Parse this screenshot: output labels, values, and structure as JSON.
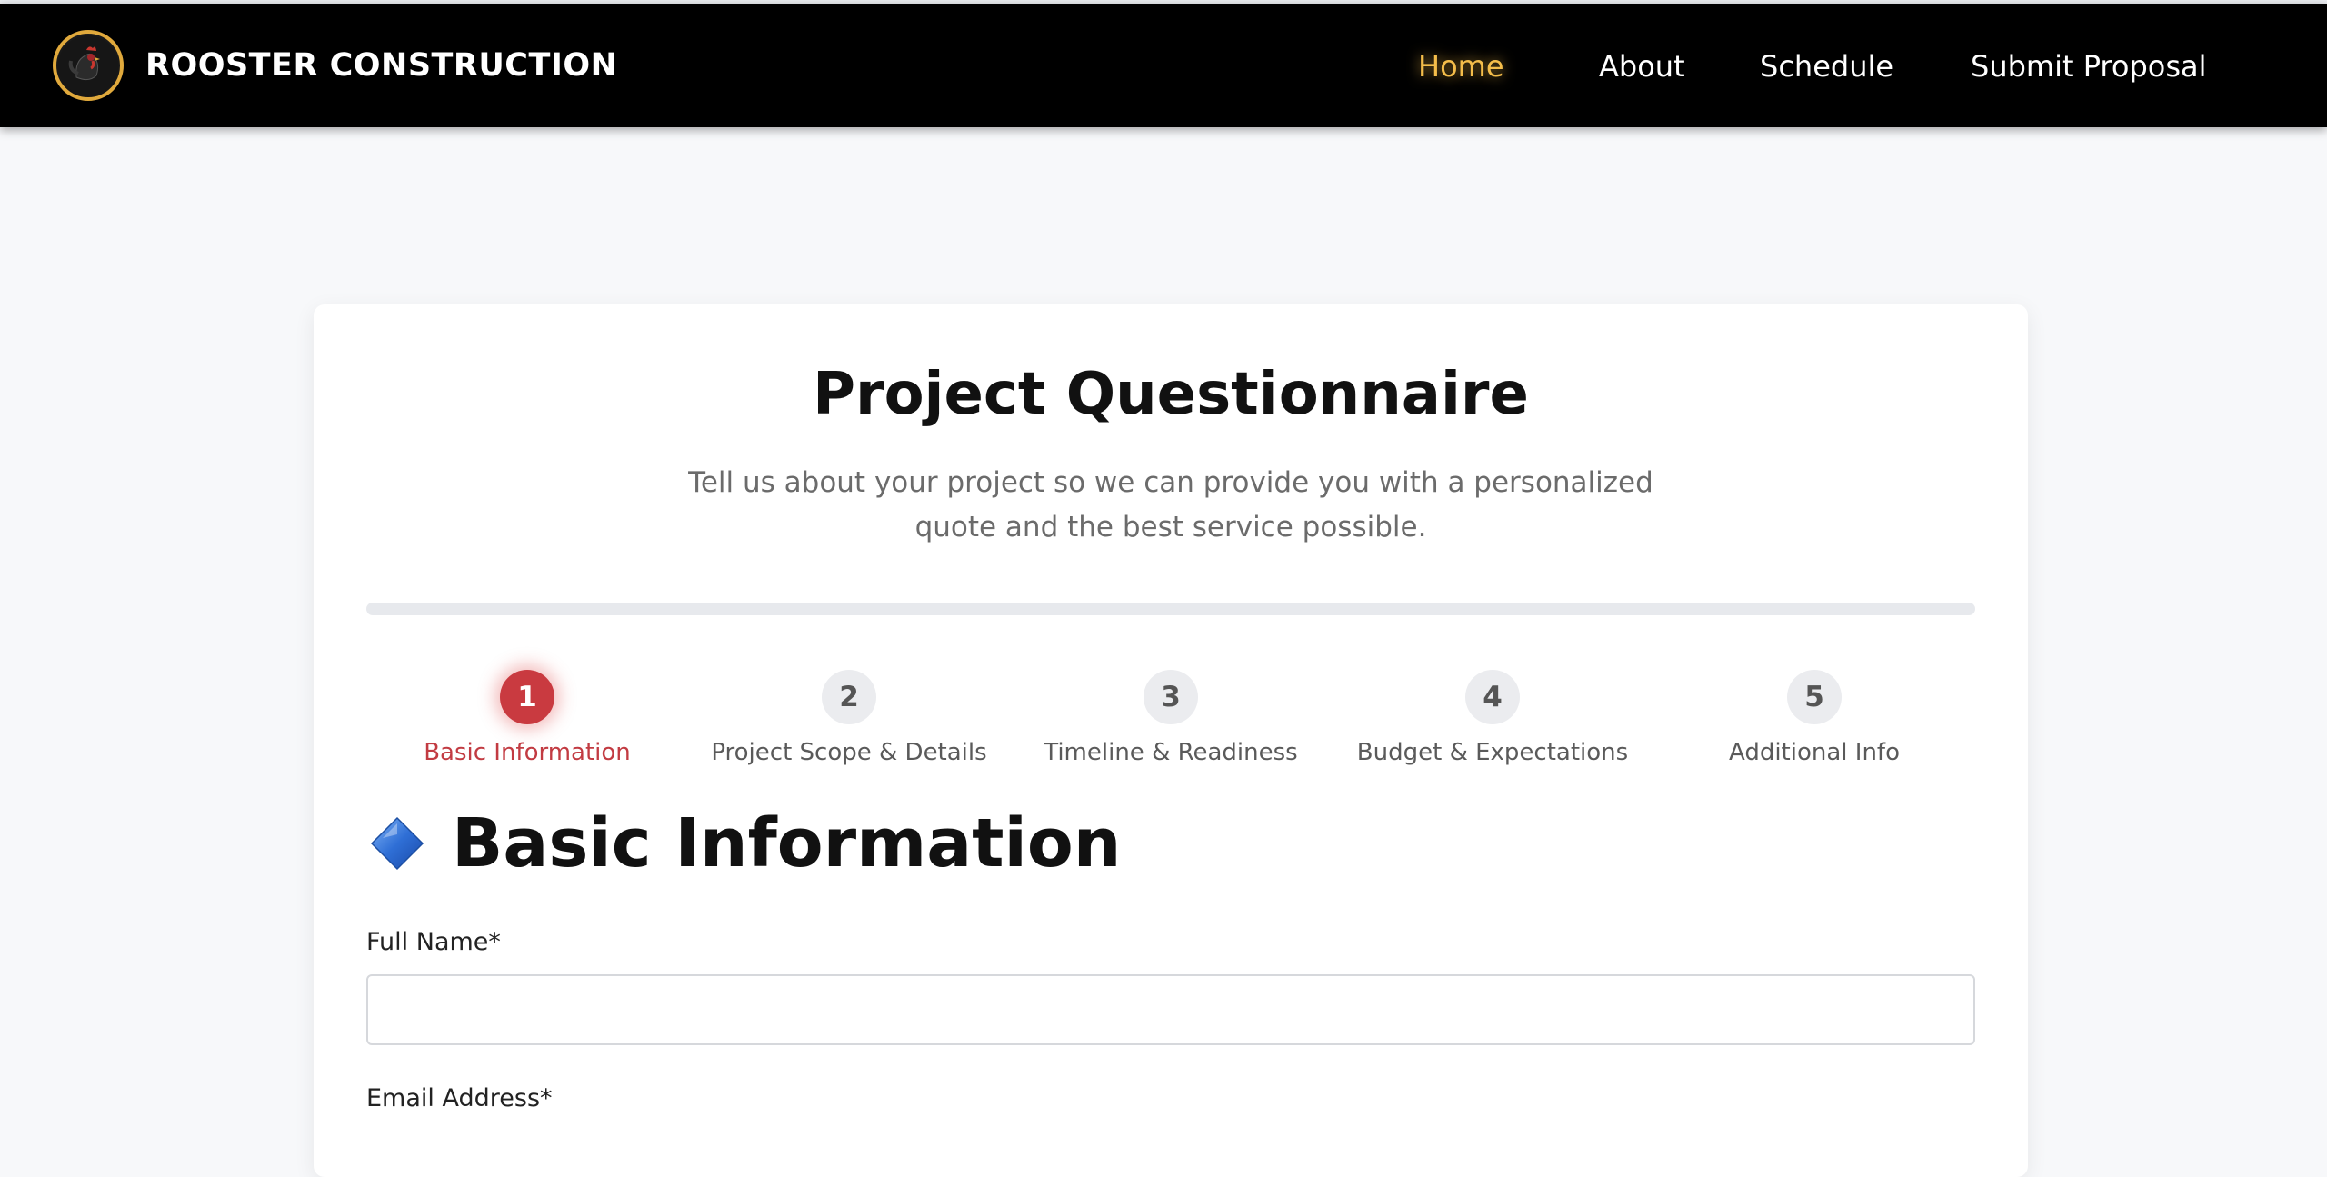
{
  "header": {
    "brand_name": "ROOSTER CONSTRUCTION",
    "logo_icon": "rooster-logo-icon",
    "nav": [
      {
        "label": "Home",
        "active": true
      },
      {
        "label": "About",
        "active": false
      },
      {
        "label": "Schedule",
        "active": false
      },
      {
        "label": "Submit Proposal",
        "active": false
      }
    ]
  },
  "form": {
    "title": "Project Questionnaire",
    "subtitle": "Tell us about your project so we can provide you with a personalized quote and the best service possible.",
    "progress_percent": 0,
    "steps": [
      {
        "number": "1",
        "label": "Basic Information",
        "active": true
      },
      {
        "number": "2",
        "label": "Project Scope & Details",
        "active": false
      },
      {
        "number": "3",
        "label": "Timeline & Readiness",
        "active": false
      },
      {
        "number": "4",
        "label": "Budget & Expectations",
        "active": false
      },
      {
        "number": "5",
        "label": "Additional Info",
        "active": false
      }
    ],
    "section": {
      "icon": "blue-diamond-icon",
      "title": "Basic Information"
    },
    "fields": [
      {
        "label": "Full Name*",
        "value": "",
        "placeholder": ""
      },
      {
        "label": "Email Address*",
        "value": "",
        "placeholder": ""
      }
    ]
  },
  "colors": {
    "nav_active": "#f4bd4a",
    "accent_red": "#c93a40",
    "diamond_blue": "#2f6fd6",
    "header_bg": "#000000",
    "page_bg": "#f7f8fa"
  }
}
